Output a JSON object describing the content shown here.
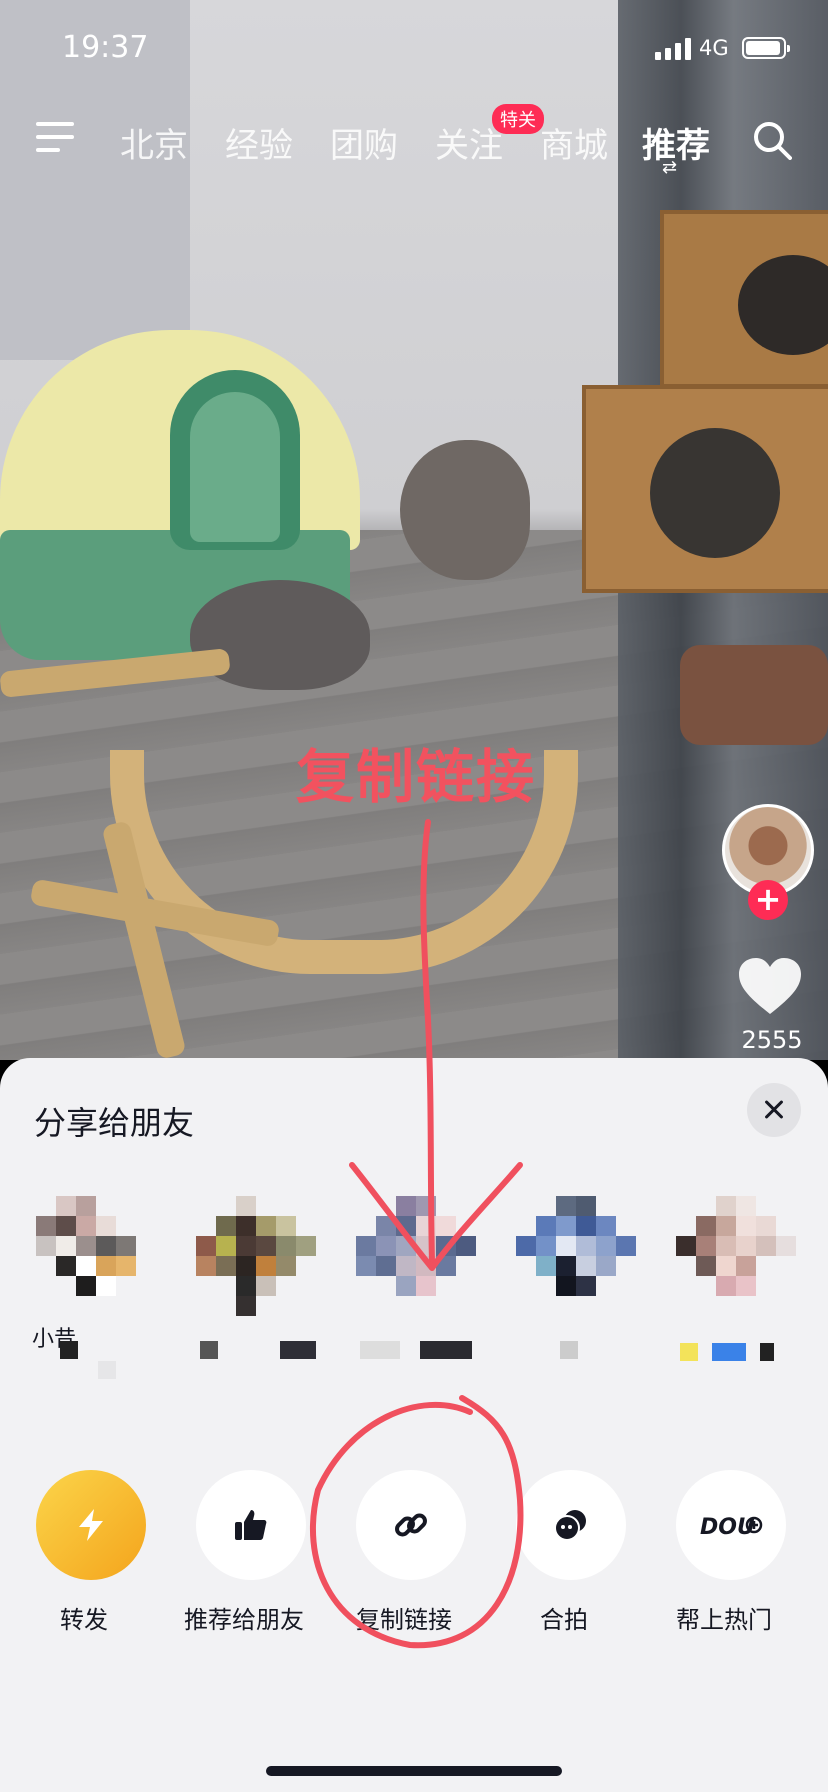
{
  "status_bar": {
    "time": "19:37",
    "network": "4G"
  },
  "top_nav": {
    "tabs": [
      "北京",
      "经验",
      "团购",
      "关注",
      "商城",
      "推荐"
    ],
    "badge": "特关",
    "active_tab": "推荐"
  },
  "side_actions": {
    "like_count": "2555"
  },
  "annotation_overlay": {
    "label": "复制链接",
    "color": "#f2525f"
  },
  "share_sheet": {
    "title": "分享给朋友",
    "friends": [
      {
        "name": "小昔"
      },
      {
        "name": ""
      },
      {
        "name": ""
      },
      {
        "name": ""
      },
      {
        "name": ""
      }
    ],
    "actions": [
      {
        "label": "转发",
        "icon": "lightning-icon"
      },
      {
        "label": "推荐给朋友",
        "icon": "thumbs-up-icon"
      },
      {
        "label": "复制链接",
        "icon": "link-icon"
      },
      {
        "label": "合拍",
        "icon": "duet-icon"
      },
      {
        "label": "帮上热门",
        "icon": "dou-plus-icon"
      }
    ]
  },
  "colors": {
    "accent": "#fe2c55",
    "sheet_bg": "#f2f2f4",
    "annotation": "#f2525f"
  }
}
